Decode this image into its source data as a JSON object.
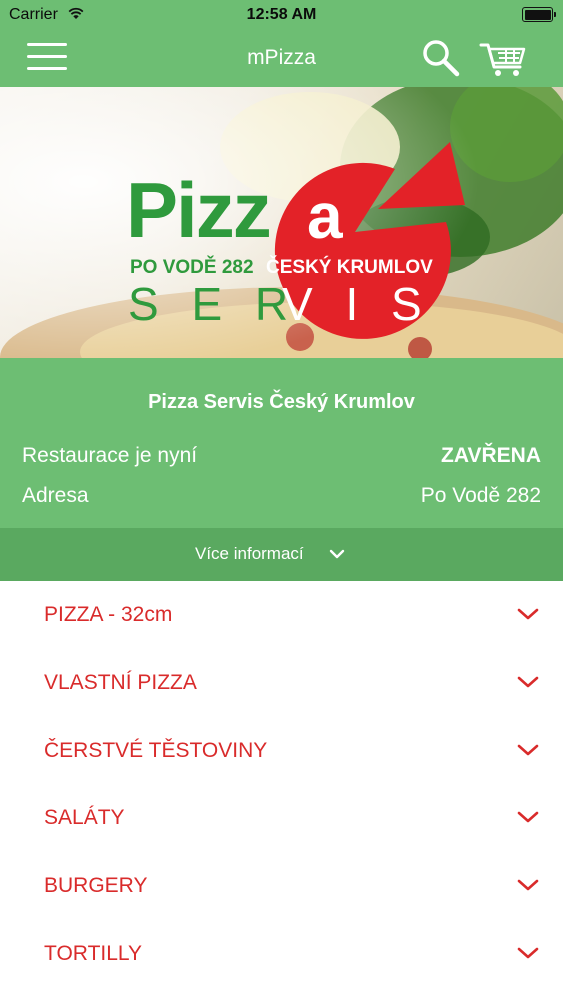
{
  "status_bar": {
    "carrier": "Carrier",
    "time": "12:58 AM"
  },
  "nav": {
    "title": "mPizza",
    "menu_icon": "hamburger-menu-icon",
    "search_icon": "search-icon",
    "cart_icon": "shopping-cart-icon"
  },
  "hero": {
    "logo_word_pizz": "Pizz",
    "logo_word_a": "a",
    "logo_address": "PO VODĚ 282",
    "logo_city": "ČESKÝ KRUMLOV",
    "logo_servis_left": "S E R",
    "logo_servis_right": "V I S"
  },
  "info": {
    "restaurant_name": "Pizza Servis Český Krumlov",
    "status_label": "Restaurace je nyní",
    "status_value": "ZAVŘENA",
    "address_label": "Adresa",
    "address_value": "Po Vodě 282"
  },
  "more_info": {
    "label": "Více informací"
  },
  "categories": [
    {
      "label": "PIZZA - 32cm"
    },
    {
      "label": "VLASTNÍ PIZZA"
    },
    {
      "label": "ČERSTVÉ TĚSTOVINY"
    },
    {
      "label": "SALÁTY"
    },
    {
      "label": "BURGERY"
    },
    {
      "label": "TORTILLY"
    }
  ],
  "colors": {
    "brand_green": "#6dbe73",
    "dark_green": "#5aa960",
    "accent_red": "#d92b2b",
    "logo_red": "#e32228",
    "logo_green": "#2f9a3d"
  }
}
